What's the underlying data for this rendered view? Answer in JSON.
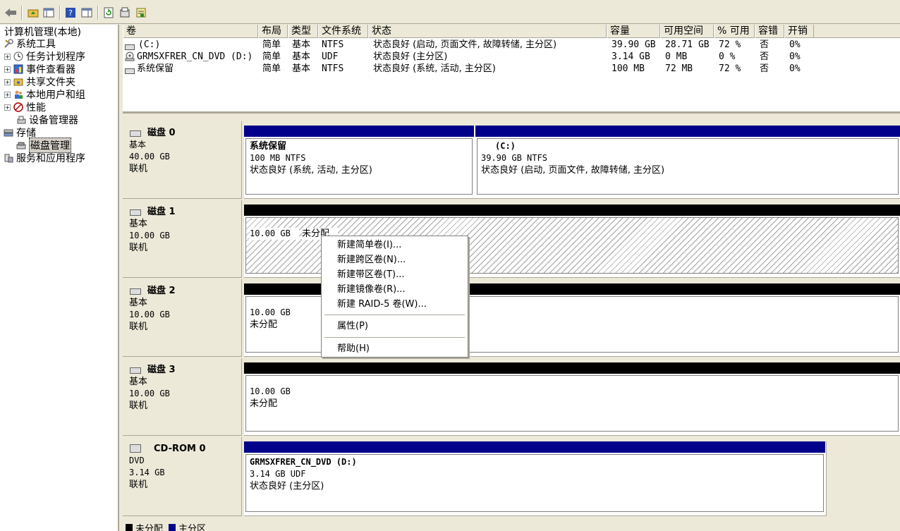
{
  "toolbar": {
    "icons": [
      "back-arrow-icon",
      "up-folder-icon",
      "show-hide-tree-icon",
      "help-icon",
      "show-pane-icon",
      "refresh-icon",
      "properties-icon",
      "export-icon"
    ]
  },
  "tree": {
    "root": "计算机管理(本地)",
    "items": [
      {
        "label": "系统工具",
        "level": 0
      },
      {
        "label": "任务计划程序",
        "level": 1
      },
      {
        "label": "事件查看器",
        "level": 1
      },
      {
        "label": "共享文件夹",
        "level": 1
      },
      {
        "label": "本地用户和组",
        "level": 1
      },
      {
        "label": "性能",
        "level": 1
      },
      {
        "label": "设备管理器",
        "level": 1
      },
      {
        "label": "存储",
        "level": 0
      },
      {
        "label": "磁盘管理",
        "level": 1
      },
      {
        "label": "服务和应用程序",
        "level": 0
      }
    ],
    "expand_glyph": "+"
  },
  "volume_list": {
    "headers": [
      "卷",
      "布局",
      "类型",
      "文件系统",
      "状态",
      "容量",
      "可用空间",
      "% 可用",
      "容错",
      "开销"
    ],
    "rows": [
      [
        "(C:)",
        "简单",
        "基本",
        "NTFS",
        "状态良好 (启动, 页面文件, 故障转储, 主分区)",
        "39.90 GB",
        "28.71 GB",
        "72 %",
        "否",
        "0%"
      ],
      [
        "GRMSXFRER_CN_DVD (D:)",
        "简单",
        "基本",
        "UDF",
        "状态良好 (主分区)",
        "3.14 GB",
        "0 MB",
        "0 %",
        "否",
        "0%"
      ],
      [
        "系统保留",
        "简单",
        "基本",
        "NTFS",
        "状态良好 (系统, 活动, 主分区)",
        "100 MB",
        "72 MB",
        "72 %",
        "否",
        "0%"
      ]
    ]
  },
  "disks": [
    {
      "name": "磁盘 0",
      "type": "基本",
      "size": "40.00 GB",
      "state": "联机",
      "partitions": [
        {
          "title": "系统保留",
          "size_fs": "100 MB NTFS",
          "status": "状态良好 (系统, 活动, 主分区)"
        },
        {
          "title": "(C:)",
          "size_fs": "39.90 GB NTFS",
          "status": "状态良好 (启动, 页面文件, 故障转储, 主分区)"
        }
      ]
    },
    {
      "name": "磁盘 1",
      "type": "基本",
      "size": "10.00 GB",
      "state": "联机",
      "partitions": [
        {
          "size_fs": "10.00 GB",
          "status": "未分配"
        }
      ]
    },
    {
      "name": "磁盘 2",
      "type": "基本",
      "size": "10.00 GB",
      "state": "联机",
      "partitions": [
        {
          "size_fs": "10.00 GB",
          "status": "未分配"
        }
      ]
    },
    {
      "name": "磁盘 3",
      "type": "基本",
      "size": "10.00 GB",
      "state": "联机",
      "partitions": [
        {
          "size_fs": "10.00 GB",
          "status": "未分配"
        }
      ]
    },
    {
      "name": "CD-ROM 0",
      "type": "DVD",
      "size": "3.14 GB",
      "state": "联机",
      "partitions": [
        {
          "title": "GRMSXFRER_CN_DVD  (D:)",
          "size_fs": "3.14 GB UDF",
          "status": "状态良好 (主分区)"
        }
      ]
    }
  ],
  "context_menu": {
    "items": [
      "新建简单卷(I)...",
      "新建跨区卷(N)...",
      "新建带区卷(T)...",
      "新建镜像卷(R)...",
      "新建 RAID-5 卷(W)...",
      "属性(P)",
      "帮助(H)"
    ]
  },
  "legend": {
    "items": [
      "未分配",
      "主分区"
    ],
    "colors": [
      "#000000",
      "#00008b"
    ]
  },
  "colors": {
    "primary_partition": "#00008b",
    "unallocated": "#000000",
    "selection": "#d4d0c8"
  }
}
